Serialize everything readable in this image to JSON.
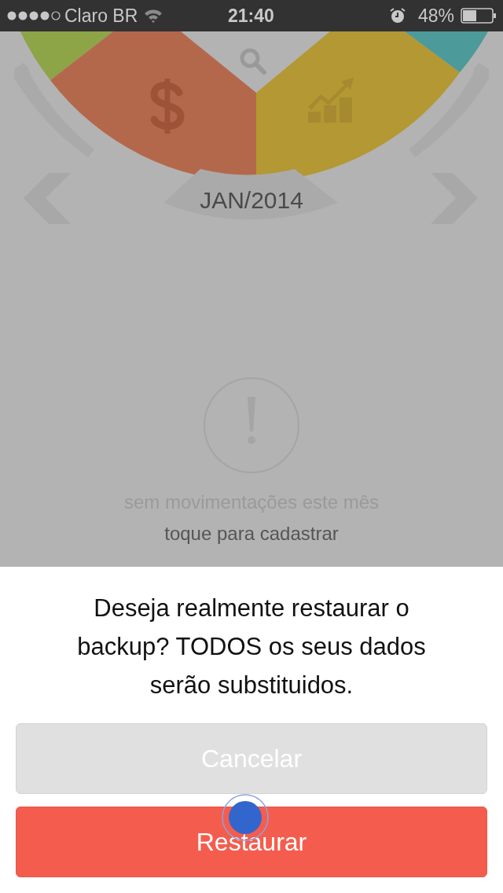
{
  "status_bar": {
    "carrier": "Claro BR",
    "time": "21:40",
    "battery": "48%"
  },
  "wheel": {
    "month": "JAN/2014"
  },
  "empty_state": {
    "message": "sem movimentações este mês",
    "action": "toque para cadastrar"
  },
  "dialog": {
    "message": "Deseja realmente restaurar o backup? TODOS os seus dados serão substituidos.",
    "buttons": [
      {
        "label": "Cancelar",
        "kind": "cancel"
      },
      {
        "label": "Restaurar",
        "kind": "confirm"
      }
    ]
  }
}
